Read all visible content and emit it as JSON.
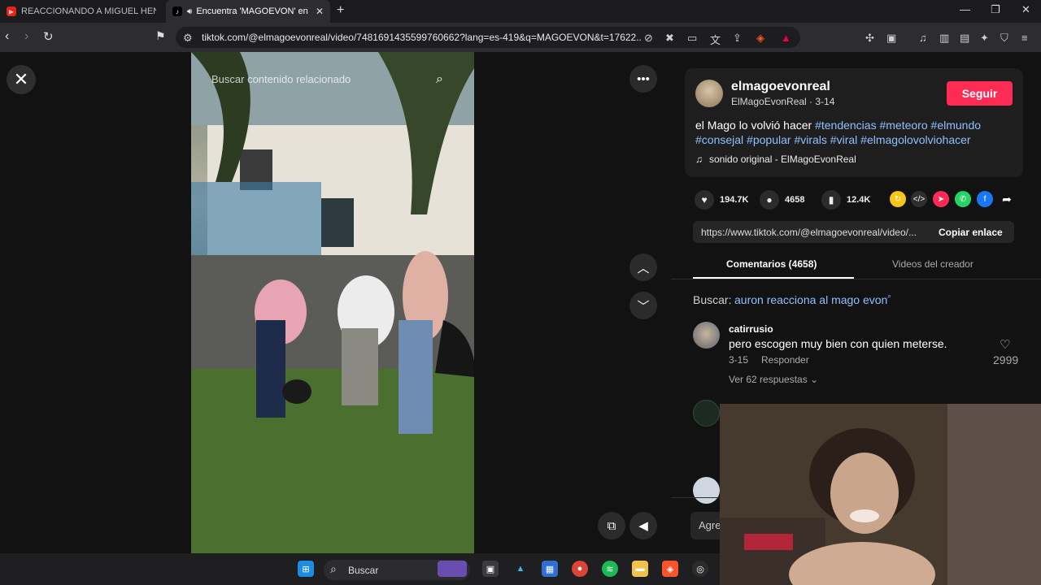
{
  "browser": {
    "tabs": [
      {
        "label": "REACCIONANDO A MIGUEL HENAO",
        "active": false,
        "favicon": "youtube-icon"
      },
      {
        "label": "Encuentra 'MAGOEVON' en TikTok",
        "active": true,
        "favicon": "tiktok-icon"
      }
    ],
    "url": "tiktok.com/@elmagoevonreal/video/7481691435599760662?lang=es-419&q=MAGOEVON&t=17622..."
  },
  "video": {
    "search_placeholder": "Buscar contenido relacionado"
  },
  "post": {
    "username": "elmagoevonreal",
    "display_name": "ElMagoEvonReal",
    "date": "3-14",
    "subline": "ElMagoEvonReal · 3-14",
    "follow_label": "Seguir",
    "description_prefix": "el Mago lo volvió hacer ",
    "hashtags": [
      "#tendencias",
      "#meteoro",
      "#elmundo",
      "#consejal",
      "#popular",
      "#virals",
      "#viral",
      "#elmagolovolviohacer"
    ],
    "sound": "sonido original - ElMagoEvonReal"
  },
  "stats": {
    "likes": "194.7K",
    "comments": "4658",
    "saves": "12.4K"
  },
  "share": {
    "link": "https://www.tiktok.com/@elmagoevonreal/video/...",
    "copy_label": "Copiar enlace"
  },
  "panel_tabs": {
    "comments": "Comentarios (4658)",
    "creator_videos": "Videos del creador"
  },
  "related_search": {
    "label": "Buscar:",
    "query": "auron reacciona al mago evon"
  },
  "comments": [
    {
      "user": "catirrusio",
      "text": "pero escogen muy bien con quien meterse.",
      "date": "3-15",
      "reply_label": "Responder",
      "likes": "2999",
      "more_replies": "Ver 62 respuestas"
    }
  ],
  "add_comment_placeholder": "Agreg",
  "taskbar": {
    "search_label": "Buscar"
  },
  "colors": {
    "accent_follow": "#fe2c55",
    "hashtag": "#8fc0ff",
    "background": "#121212"
  }
}
